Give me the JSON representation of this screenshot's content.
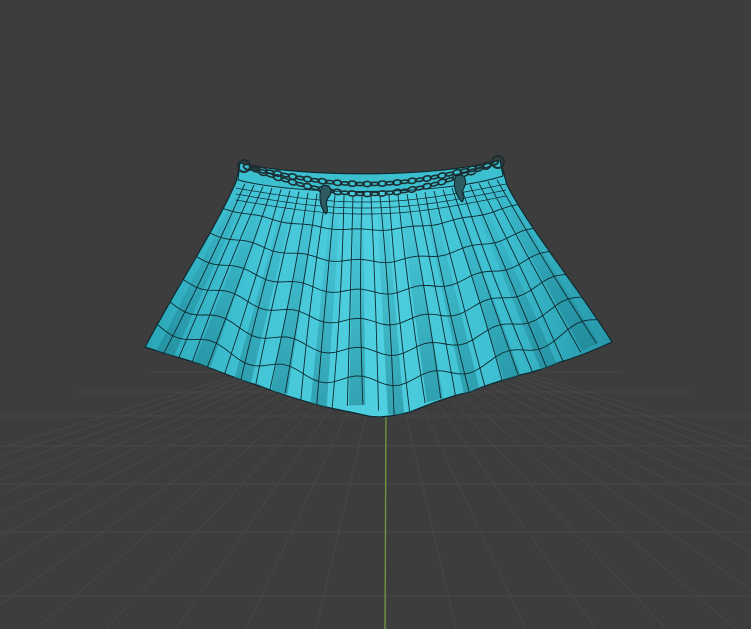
{
  "viewport": {
    "background": "#3d3d3d",
    "grid_color": "#474747",
    "y_axis_color": "#6f9a3e"
  },
  "model": {
    "object": "pleated-skirt",
    "display": "wireframe-overlay",
    "fabric_color": "#3fc3d4",
    "wire_color": "#0e2a30",
    "belt": "chain-belt",
    "chain_color": "#1c2f33"
  }
}
